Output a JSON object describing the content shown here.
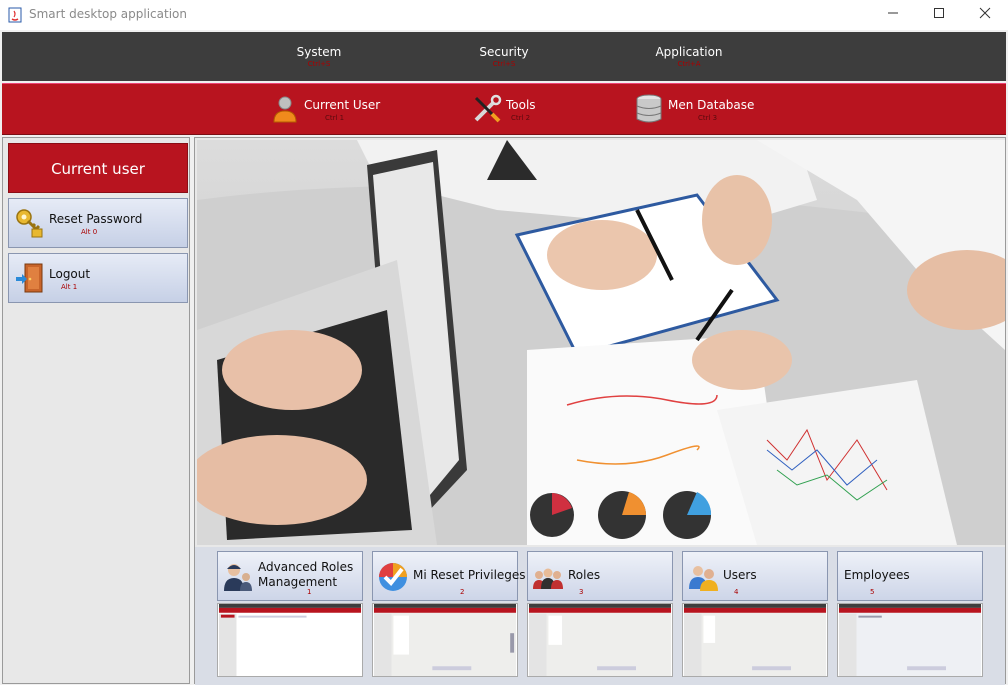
{
  "window": {
    "title": "Smart desktop application",
    "minimize": "—",
    "maximize": "☐",
    "close": "✕"
  },
  "menu": [
    {
      "label": "System",
      "shortcut": "Ctrl+S"
    },
    {
      "label": "Security",
      "shortcut": "Ctrl+S"
    },
    {
      "label": "Application",
      "shortcut": "Ctrl+A"
    }
  ],
  "toolbar": [
    {
      "label": "Current User",
      "shortcut": "Ctrl 1",
      "icon": "user-icon"
    },
    {
      "label": "Tools",
      "shortcut": "Ctrl 2",
      "icon": "tools-icon"
    },
    {
      "label": "Men Database",
      "shortcut": "Ctrl 3",
      "icon": "database-icon"
    }
  ],
  "sidebar": {
    "header": "Current user",
    "buttons": [
      {
        "label": "Reset Password",
        "shortcut": "Alt 0",
        "icon": "key-lock-icon"
      },
      {
        "label": "Logout",
        "shortcut": "Alt 1",
        "icon": "logout-door-icon"
      }
    ]
  },
  "cards": [
    {
      "label": "Advanced Roles Management",
      "shortcut": "1",
      "icon": "admin-users-icon"
    },
    {
      "label": "Mi Reset Privileges",
      "shortcut": "2",
      "icon": "checkmark-circle-icon"
    },
    {
      "label": "Roles",
      "shortcut": "3",
      "icon": "people-group-icon"
    },
    {
      "label": "Users",
      "shortcut": "4",
      "icon": "users-icon"
    },
    {
      "label": "Employees",
      "shortcut": "5",
      "icon": ""
    }
  ],
  "colors": {
    "accent_red": "#b8141f",
    "menubar_dark": "#3d3d3d",
    "button_blue": "#c6d0e6"
  }
}
